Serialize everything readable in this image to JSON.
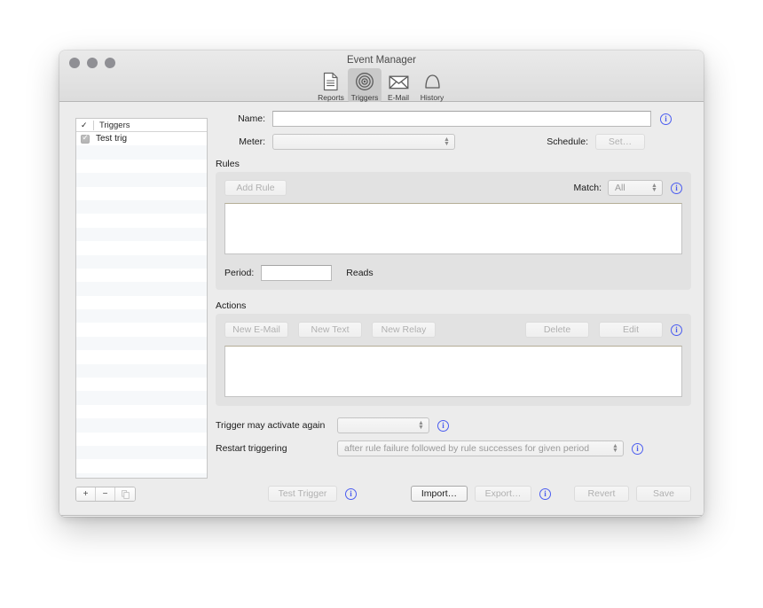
{
  "window": {
    "title": "Event Manager",
    "traffic_lights": [
      "close-button",
      "minimize-button",
      "zoom-button"
    ]
  },
  "toolbar": {
    "items": [
      {
        "label": "Reports",
        "icon": "document-icon",
        "selected": false
      },
      {
        "label": "Triggers",
        "icon": "target-icon",
        "selected": true
      },
      {
        "label": "E-Mail",
        "icon": "envelope-icon",
        "selected": false
      },
      {
        "label": "History",
        "icon": "bell-icon",
        "selected": false
      }
    ]
  },
  "sidebar": {
    "header_label": "Triggers",
    "header_check": "✓",
    "rows": [
      {
        "label": "Test trig",
        "checked": true
      }
    ],
    "empty_row_count": 25,
    "controls": {
      "add_label": "+",
      "remove_label": "−",
      "duplicate_icon": "duplicate-icon"
    }
  },
  "form": {
    "name_label": "Name:",
    "name_value": "",
    "meter_label": "Meter:",
    "meter_value": "",
    "schedule_label": "Schedule:",
    "schedule_button": "Set…",
    "info_glyph": "i"
  },
  "rules": {
    "group_label": "Rules",
    "add_rule_button": "Add Rule",
    "match_label": "Match:",
    "match_value": "All",
    "rules_list": [],
    "period_label": "Period:",
    "period_value": "",
    "period_unit": "Reads"
  },
  "actions": {
    "group_label": "Actions",
    "new_email_button": "New E-Mail",
    "new_text_button": "New Text",
    "new_relay_button": "New Relay",
    "delete_button": "Delete",
    "edit_button": "Edit",
    "actions_list": []
  },
  "options": {
    "activate_again_label": "Trigger may activate again",
    "activate_again_value": "",
    "restart_label": "Restart triggering",
    "restart_value": "after rule failure followed by rule successes for given period"
  },
  "footer": {
    "test_trigger_button": "Test Trigger",
    "import_button": "Import…",
    "export_button": "Export…",
    "revert_button": "Revert",
    "save_button": "Save"
  }
}
